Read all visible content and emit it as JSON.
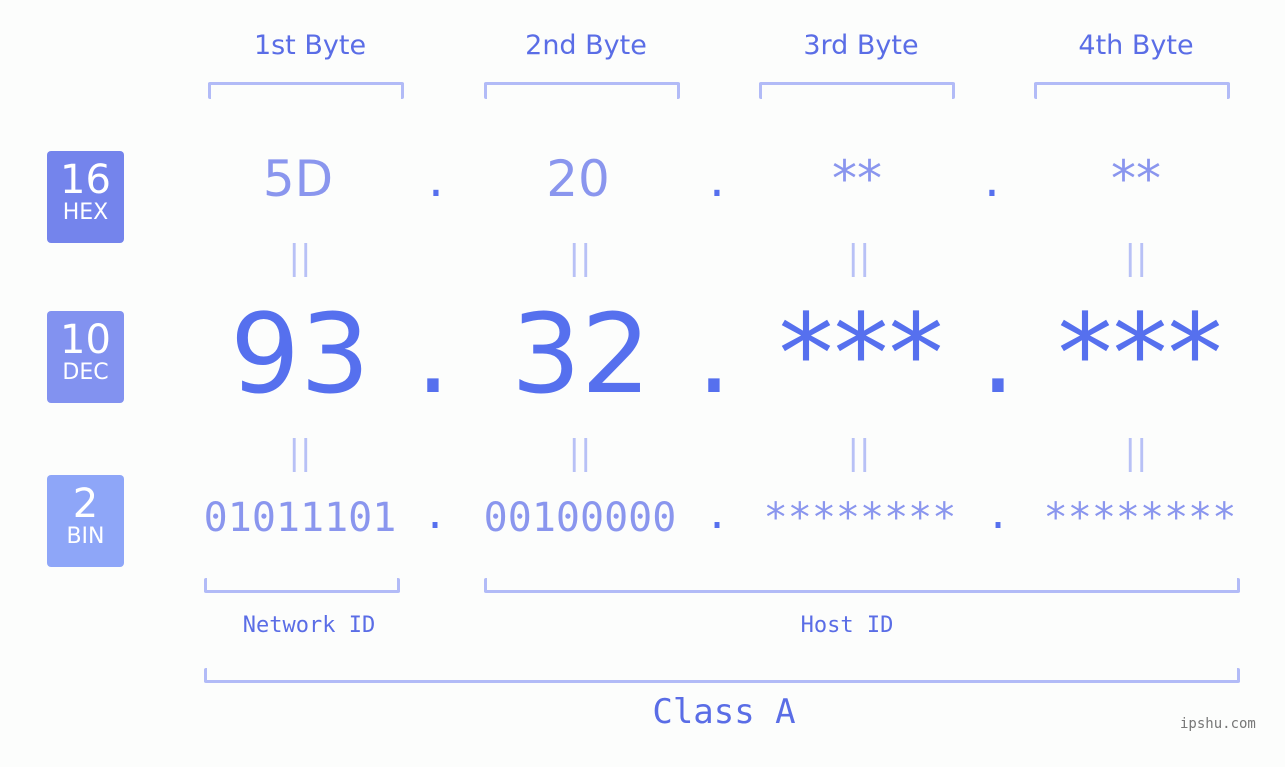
{
  "byte_headers": [
    "1st Byte",
    "2nd Byte",
    "3rd Byte",
    "4th Byte"
  ],
  "badges": [
    {
      "number": "16",
      "label": "HEX",
      "color": "#7484ec"
    },
    {
      "number": "10",
      "label": "DEC",
      "color": "#8292f0"
    },
    {
      "number": "2",
      "label": "BIN",
      "color": "#8ea6f8"
    }
  ],
  "hex": [
    "5D",
    "20",
    "**",
    "**"
  ],
  "dec": [
    "93",
    "32",
    "***",
    "***"
  ],
  "bin": [
    "01011101",
    "00100000",
    "********",
    "********"
  ],
  "separator": ".",
  "equals": "||",
  "network_id_label": "Network ID",
  "host_id_label": "Host ID",
  "class_label": "Class A",
  "watermark": "ipshu.com"
}
